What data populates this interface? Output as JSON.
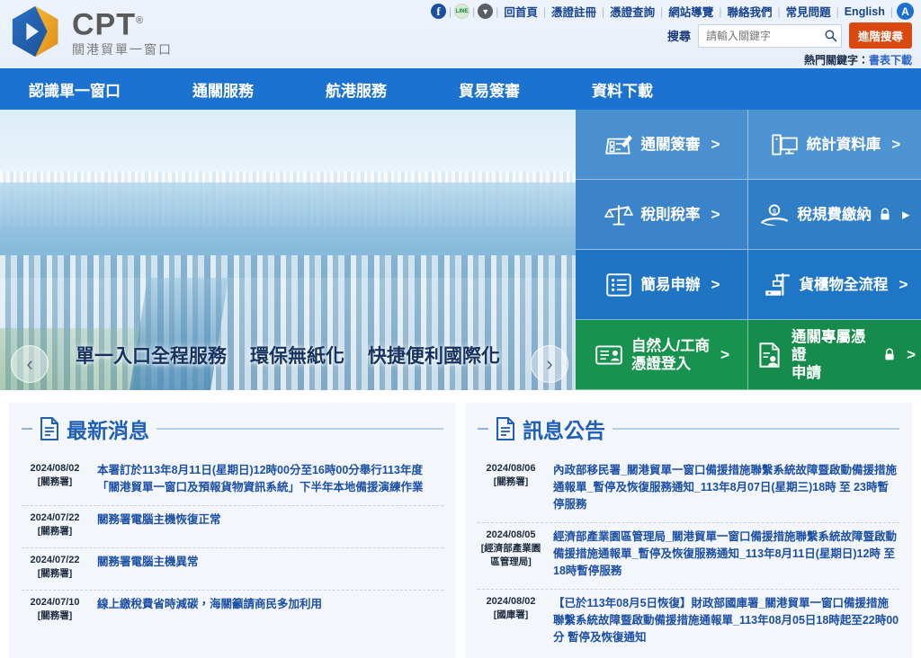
{
  "header": {
    "logo": {
      "brand": "CPT",
      "registered": "®",
      "subtitle": "關港貿單一窗口"
    },
    "social": [
      {
        "name": "facebook-icon",
        "glyph": "f"
      },
      {
        "name": "line-icon",
        "glyph": "LINE"
      },
      {
        "name": "download-icon",
        "glyph": "▼"
      }
    ],
    "links": [
      "回首頁",
      "憑證註冊",
      "憑證查詢",
      "網站導覽",
      "聯絡我們",
      "常見問題",
      "English"
    ],
    "separator": "|",
    "accessibility": {
      "label": "A",
      "name": "accessibility-icon"
    },
    "search": {
      "label": "搜尋",
      "placeholder": "請輸入關鍵字",
      "value": "",
      "advanced_label": "進階搜尋",
      "icon": "search-icon"
    },
    "hot_keywords": {
      "label": "熱門關鍵字：",
      "items": [
        "書表下載"
      ]
    }
  },
  "mainnav": {
    "items": [
      "認識單一窗口",
      "通關服務",
      "航港服務",
      "貿易簽審",
      "資料下載"
    ]
  },
  "carousel": {
    "captions": [
      "單一入口全程服務",
      "環保無紙化",
      "快捷便利國際化"
    ],
    "prev": "‹",
    "next": "›",
    "dots": 1,
    "active_dot": 0,
    "dot_color": "#22b14c"
  },
  "tiles": [
    {
      "label": "通關簽審",
      "icon": "form-pencil-icon",
      "arrow": ">",
      "lock": false,
      "color": "#4a8fd0"
    },
    {
      "label": "統計資料庫",
      "icon": "computer-icon",
      "arrow": ">",
      "lock": false,
      "color": "#4e93d2"
    },
    {
      "label": "稅則稅率",
      "icon": "scales-icon",
      "arrow": ">",
      "lock": false,
      "color": "#3c84c9"
    },
    {
      "label": "稅規費繳納",
      "icon": "hand-coin-icon",
      "arrow": "▸",
      "lock": true,
      "color": "#2f7ec6"
    },
    {
      "label": "簡易申辦",
      "icon": "list-icon",
      "arrow": ">",
      "lock": false,
      "color": "#1f74c3"
    },
    {
      "label": "貨櫃物全流程",
      "icon": "crane-icon",
      "arrow": ">",
      "lock": false,
      "color": "#1f76c6"
    },
    {
      "label": "自然人/工商\n憑證登入",
      "icon": "id-card-icon",
      "arrow": ">",
      "lock": false,
      "color": "#18924f"
    },
    {
      "label": "通關專屬憑證\n申請",
      "icon": "document-person-icon",
      "arrow": ">",
      "lock": true,
      "color": "#158c4b"
    }
  ],
  "news_panel": {
    "title": "最新消息",
    "icon": "document-icon",
    "items": [
      {
        "date": "2024/08/02",
        "org": "[關務署]",
        "title": "本署訂於113年8月11日(星期日)12時00分至16時00分舉行113年度「關港貿單一窗口及預報貨物資訊系統」下半年本地備援演練作業"
      },
      {
        "date": "2024/07/22",
        "org": "[關務署]",
        "title": "關務署電腦主機恢復正常"
      },
      {
        "date": "2024/07/22",
        "org": "[關務署]",
        "title": "關務署電腦主機異常"
      },
      {
        "date": "2024/07/10",
        "org": "[關務署]",
        "title": "線上繳稅費省時減碳，海關籲請商民多加利用"
      }
    ]
  },
  "announce_panel": {
    "title": "訊息公告",
    "icon": "document-icon",
    "items": [
      {
        "date": "2024/08/06",
        "org": "[關務署]",
        "title": "內政部移民署_關港貿單一窗口備援措施聯繫系統故障暨啟動備援措施通報單_暫停及恢復服務通知_113年8月07日(星期三)18時 至 23時暫停服務"
      },
      {
        "date": "2024/08/05",
        "org": "[經濟部產業園區管理局]",
        "title": "經濟部產業園區管理局_關港貿單一窗口備援措施聯繫系統故障暨啟動備援措施通報單_暫停及恢復服務通知_113年8月11日(星期日)12時 至 18時暫停服務"
      },
      {
        "date": "2024/08/02",
        "org": "[國庫署]",
        "title": "【已於113年08月5日恢復】財政部國庫署_關港貿單一窗口備援措施聯繫系統故障暨啟動備援措施通報單_113年08月05日18時起至22時00分 暫停及恢復通知"
      }
    ]
  },
  "colors": {
    "nav_blue": "#1b72d0",
    "accent_orange": "#d8480f",
    "link_blue": "#1c4fa3",
    "panel_bg": "#f3f7fc",
    "tile_green": "#18924f"
  }
}
